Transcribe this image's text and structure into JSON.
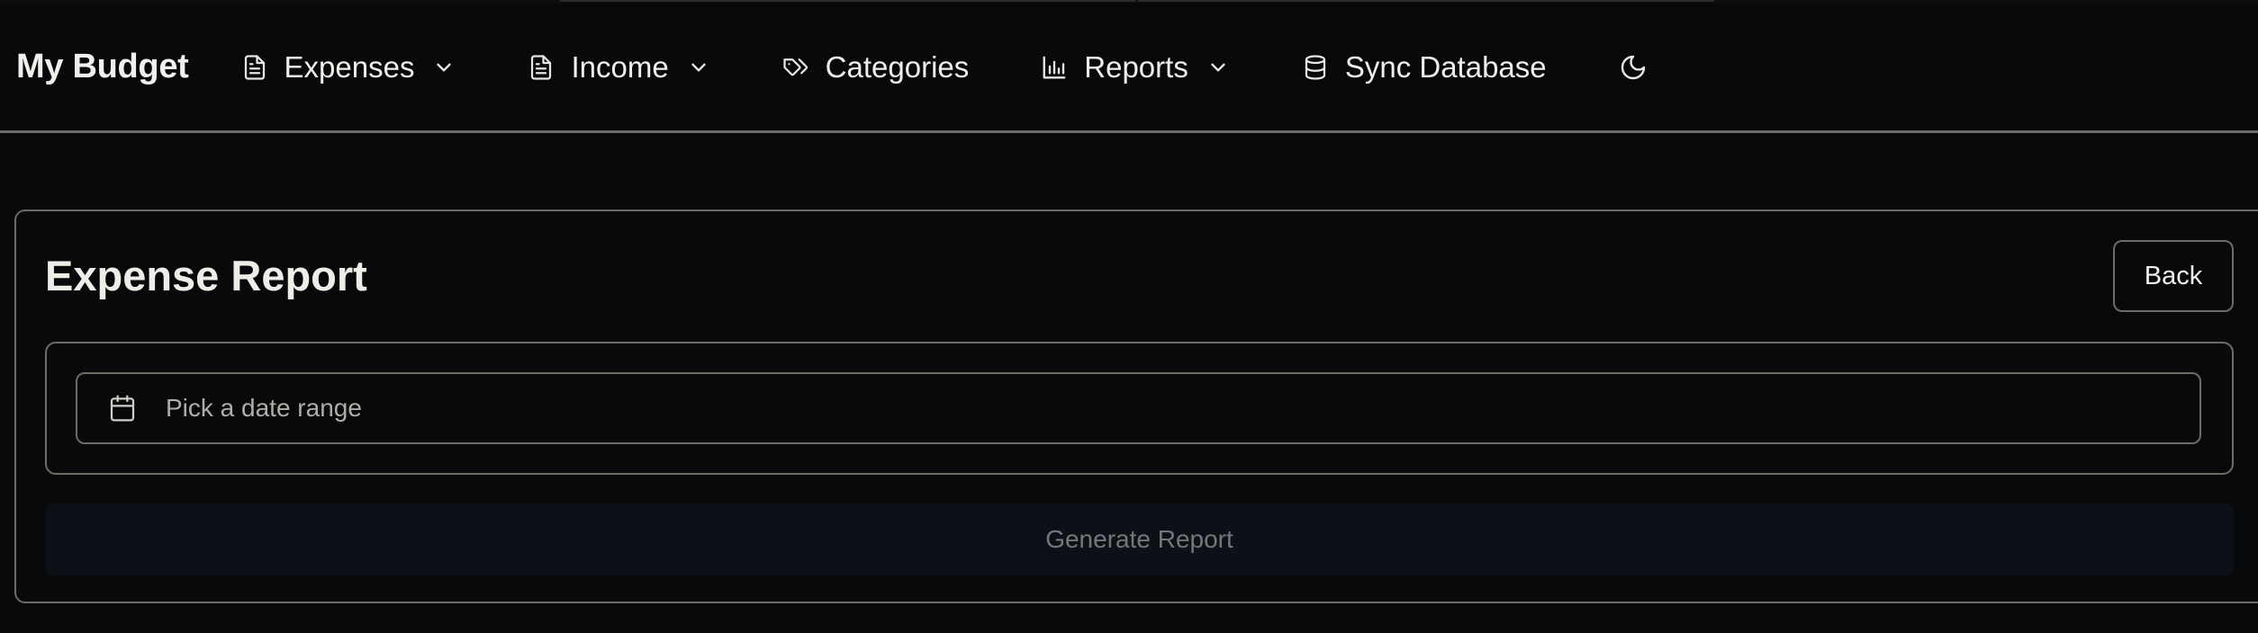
{
  "app": {
    "brand": "My Budget"
  },
  "nav": {
    "items": [
      {
        "label": "Expenses",
        "icon": "file-text-icon",
        "dropdown": true
      },
      {
        "label": "Income",
        "icon": "file-text-icon",
        "dropdown": true
      },
      {
        "label": "Categories",
        "icon": "tags-icon",
        "dropdown": false
      },
      {
        "label": "Reports",
        "icon": "bar-chart-icon",
        "dropdown": true
      },
      {
        "label": "Sync Database",
        "icon": "database-icon",
        "dropdown": false
      }
    ],
    "theme_toggle_icon": "moon-icon"
  },
  "report": {
    "title": "Expense Report",
    "back_label": "Back",
    "date_range_placeholder": "Pick a date range",
    "date_icon": "calendar-icon",
    "generate_label": "Generate Report"
  },
  "colors": {
    "background": "#08090b",
    "border": "#6e6b66",
    "text": "#f0eee9",
    "muted_text": "#b0ada7",
    "disabled_button_bg": "#0d1117",
    "disabled_button_text": "#76767a"
  }
}
